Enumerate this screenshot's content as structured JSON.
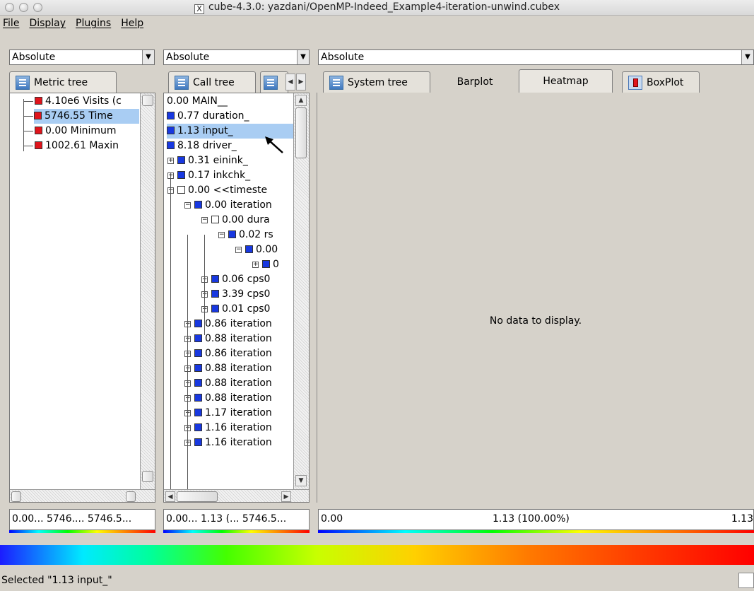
{
  "window": {
    "title": "cube-4.3.0: yazdani/OpenMP-Indeed_Example4-iteration-unwind.cubex",
    "x_icon": "X"
  },
  "menu": [
    "File",
    "Display",
    "Plugins",
    "Help"
  ],
  "combos": {
    "metric": "Absolute",
    "call": "Absolute",
    "system": "Absolute"
  },
  "tabs": {
    "metric_tree": "Metric tree",
    "call_tree": "Call tree",
    "system_tree": "System tree",
    "barplot": "Barplot",
    "heatmap": "Heatmap",
    "boxplot": "BoxPlot"
  },
  "metric_tree": [
    {
      "label": "4.10e6 Visits (c",
      "color": "red"
    },
    {
      "label": "5746.55 Time",
      "color": "red",
      "selected": true
    },
    {
      "label": "0.00 Minimum",
      "color": "red"
    },
    {
      "label": "1002.61 Maxin",
      "color": "red"
    }
  ],
  "call_tree": [
    {
      "label": "0.00 MAIN__",
      "depth": 0,
      "color": "none"
    },
    {
      "label": "0.77 duration_",
      "depth": 0,
      "color": "blue"
    },
    {
      "label": "1.13 input_",
      "depth": 0,
      "color": "blue",
      "selected": true
    },
    {
      "label": "8.18 driver_",
      "depth": 0,
      "color": "blue"
    },
    {
      "label": "0.31 einink_",
      "depth": 0,
      "color": "blue",
      "expander": "plus"
    },
    {
      "label": "0.17 inkchk_",
      "depth": 0,
      "color": "blue",
      "expander": "plus"
    },
    {
      "label": "0.00 <<timeste",
      "depth": 0,
      "color": "white",
      "expander": "minus"
    },
    {
      "label": "0.00 iteration",
      "depth": 1,
      "color": "blue",
      "expander": "minus"
    },
    {
      "label": "0.00 dura",
      "depth": 2,
      "color": "white",
      "expander": "minus"
    },
    {
      "label": "0.02 rs",
      "depth": 3,
      "color": "blue",
      "expander": "minus"
    },
    {
      "label": "0.00",
      "depth": 4,
      "color": "blue",
      "expander": "minus"
    },
    {
      "label": "0",
      "depth": 5,
      "color": "blue",
      "expander": "plus"
    },
    {
      "label": "0.06 cps0",
      "depth": 2,
      "color": "blue",
      "expander": "plus"
    },
    {
      "label": "3.39 cps0",
      "depth": 2,
      "color": "blue",
      "expander": "plus"
    },
    {
      "label": "0.01 cps0",
      "depth": 2,
      "color": "blue",
      "expander": "plus"
    },
    {
      "label": "0.86 iteration",
      "depth": 1,
      "color": "blue",
      "expander": "plus"
    },
    {
      "label": "0.88 iteration",
      "depth": 1,
      "color": "blue",
      "expander": "plus"
    },
    {
      "label": "0.86 iteration",
      "depth": 1,
      "color": "blue",
      "expander": "plus"
    },
    {
      "label": "0.88 iteration",
      "depth": 1,
      "color": "blue",
      "expander": "plus"
    },
    {
      "label": "0.88 iteration",
      "depth": 1,
      "color": "blue",
      "expander": "plus"
    },
    {
      "label": "0.88 iteration",
      "depth": 1,
      "color": "blue",
      "expander": "plus"
    },
    {
      "label": "1.17 iteration",
      "depth": 1,
      "color": "blue",
      "expander": "plus"
    },
    {
      "label": "1.16 iteration",
      "depth": 1,
      "color": "blue",
      "expander": "plus"
    },
    {
      "label": "1.16 iteration",
      "depth": 1,
      "color": "blue",
      "expander": "plus"
    }
  ],
  "system_view": {
    "empty_message": "No data to display."
  },
  "value_fields": {
    "metric": "0.00... 5746.... 5746.5...",
    "call": "0.00... 1.13 (... 5746.5...",
    "system_min": "0.00",
    "system_mid": "1.13 (100.00%)",
    "system_max": "1.13"
  },
  "status": "Selected \"1.13 input_\"",
  "colors": {
    "selection": "#a9cdf3",
    "metric_square": "#e0141c",
    "call_square": "#1838e0"
  }
}
